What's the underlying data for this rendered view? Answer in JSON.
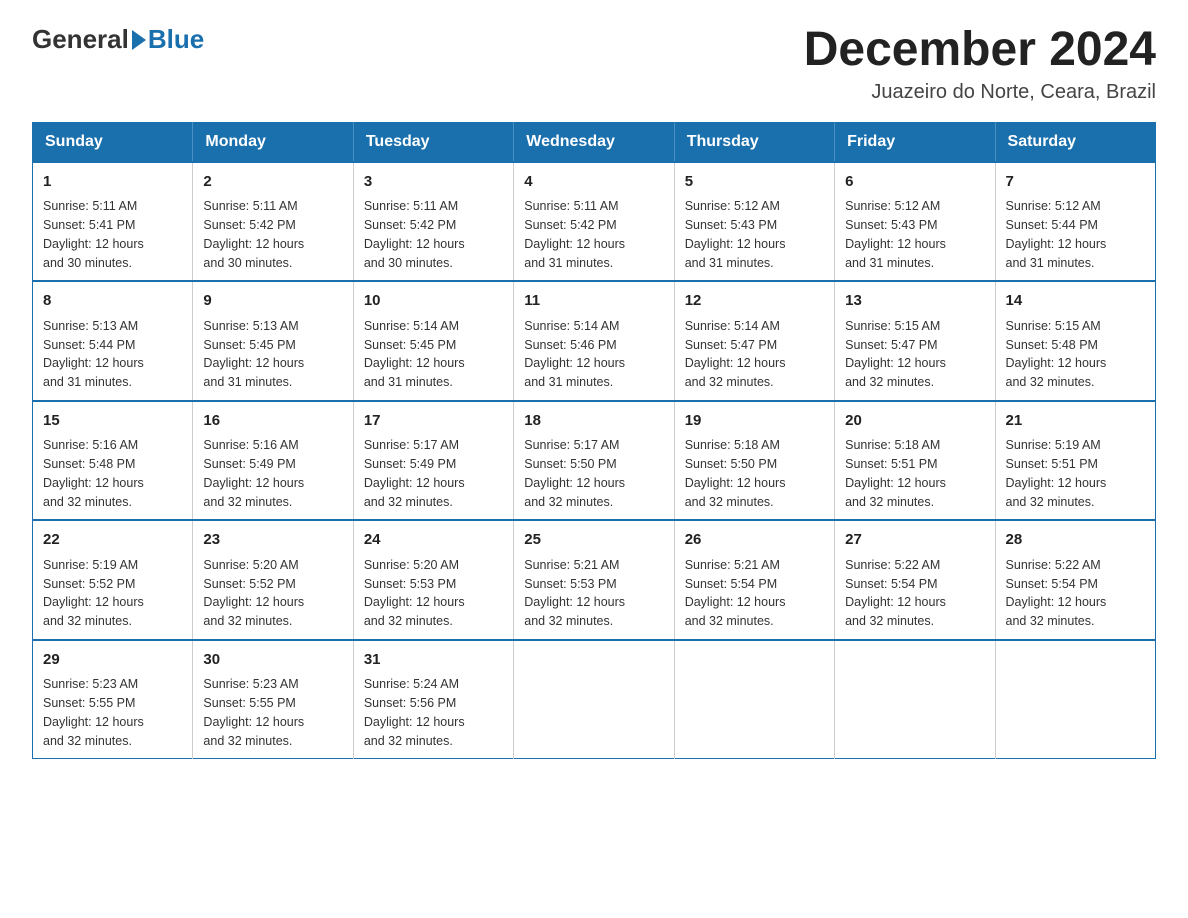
{
  "logo": {
    "general": "General",
    "blue": "Blue"
  },
  "title": "December 2024",
  "subtitle": "Juazeiro do Norte, Ceara, Brazil",
  "days_of_week": [
    "Sunday",
    "Monday",
    "Tuesday",
    "Wednesday",
    "Thursday",
    "Friday",
    "Saturday"
  ],
  "weeks": [
    [
      {
        "day": "1",
        "sunrise": "5:11 AM",
        "sunset": "5:41 PM",
        "daylight": "12 hours and 30 minutes."
      },
      {
        "day": "2",
        "sunrise": "5:11 AM",
        "sunset": "5:42 PM",
        "daylight": "12 hours and 30 minutes."
      },
      {
        "day": "3",
        "sunrise": "5:11 AM",
        "sunset": "5:42 PM",
        "daylight": "12 hours and 30 minutes."
      },
      {
        "day": "4",
        "sunrise": "5:11 AM",
        "sunset": "5:42 PM",
        "daylight": "12 hours and 31 minutes."
      },
      {
        "day": "5",
        "sunrise": "5:12 AM",
        "sunset": "5:43 PM",
        "daylight": "12 hours and 31 minutes."
      },
      {
        "day": "6",
        "sunrise": "5:12 AM",
        "sunset": "5:43 PM",
        "daylight": "12 hours and 31 minutes."
      },
      {
        "day": "7",
        "sunrise": "5:12 AM",
        "sunset": "5:44 PM",
        "daylight": "12 hours and 31 minutes."
      }
    ],
    [
      {
        "day": "8",
        "sunrise": "5:13 AM",
        "sunset": "5:44 PM",
        "daylight": "12 hours and 31 minutes."
      },
      {
        "day": "9",
        "sunrise": "5:13 AM",
        "sunset": "5:45 PM",
        "daylight": "12 hours and 31 minutes."
      },
      {
        "day": "10",
        "sunrise": "5:14 AM",
        "sunset": "5:45 PM",
        "daylight": "12 hours and 31 minutes."
      },
      {
        "day": "11",
        "sunrise": "5:14 AM",
        "sunset": "5:46 PM",
        "daylight": "12 hours and 31 minutes."
      },
      {
        "day": "12",
        "sunrise": "5:14 AM",
        "sunset": "5:47 PM",
        "daylight": "12 hours and 32 minutes."
      },
      {
        "day": "13",
        "sunrise": "5:15 AM",
        "sunset": "5:47 PM",
        "daylight": "12 hours and 32 minutes."
      },
      {
        "day": "14",
        "sunrise": "5:15 AM",
        "sunset": "5:48 PM",
        "daylight": "12 hours and 32 minutes."
      }
    ],
    [
      {
        "day": "15",
        "sunrise": "5:16 AM",
        "sunset": "5:48 PM",
        "daylight": "12 hours and 32 minutes."
      },
      {
        "day": "16",
        "sunrise": "5:16 AM",
        "sunset": "5:49 PM",
        "daylight": "12 hours and 32 minutes."
      },
      {
        "day": "17",
        "sunrise": "5:17 AM",
        "sunset": "5:49 PM",
        "daylight": "12 hours and 32 minutes."
      },
      {
        "day": "18",
        "sunrise": "5:17 AM",
        "sunset": "5:50 PM",
        "daylight": "12 hours and 32 minutes."
      },
      {
        "day": "19",
        "sunrise": "5:18 AM",
        "sunset": "5:50 PM",
        "daylight": "12 hours and 32 minutes."
      },
      {
        "day": "20",
        "sunrise": "5:18 AM",
        "sunset": "5:51 PM",
        "daylight": "12 hours and 32 minutes."
      },
      {
        "day": "21",
        "sunrise": "5:19 AM",
        "sunset": "5:51 PM",
        "daylight": "12 hours and 32 minutes."
      }
    ],
    [
      {
        "day": "22",
        "sunrise": "5:19 AM",
        "sunset": "5:52 PM",
        "daylight": "12 hours and 32 minutes."
      },
      {
        "day": "23",
        "sunrise": "5:20 AM",
        "sunset": "5:52 PM",
        "daylight": "12 hours and 32 minutes."
      },
      {
        "day": "24",
        "sunrise": "5:20 AM",
        "sunset": "5:53 PM",
        "daylight": "12 hours and 32 minutes."
      },
      {
        "day": "25",
        "sunrise": "5:21 AM",
        "sunset": "5:53 PM",
        "daylight": "12 hours and 32 minutes."
      },
      {
        "day": "26",
        "sunrise": "5:21 AM",
        "sunset": "5:54 PM",
        "daylight": "12 hours and 32 minutes."
      },
      {
        "day": "27",
        "sunrise": "5:22 AM",
        "sunset": "5:54 PM",
        "daylight": "12 hours and 32 minutes."
      },
      {
        "day": "28",
        "sunrise": "5:22 AM",
        "sunset": "5:54 PM",
        "daylight": "12 hours and 32 minutes."
      }
    ],
    [
      {
        "day": "29",
        "sunrise": "5:23 AM",
        "sunset": "5:55 PM",
        "daylight": "12 hours and 32 minutes."
      },
      {
        "day": "30",
        "sunrise": "5:23 AM",
        "sunset": "5:55 PM",
        "daylight": "12 hours and 32 minutes."
      },
      {
        "day": "31",
        "sunrise": "5:24 AM",
        "sunset": "5:56 PM",
        "daylight": "12 hours and 32 minutes."
      },
      null,
      null,
      null,
      null
    ]
  ],
  "labels": {
    "sunrise": "Sunrise:",
    "sunset": "Sunset:",
    "daylight": "Daylight:"
  }
}
